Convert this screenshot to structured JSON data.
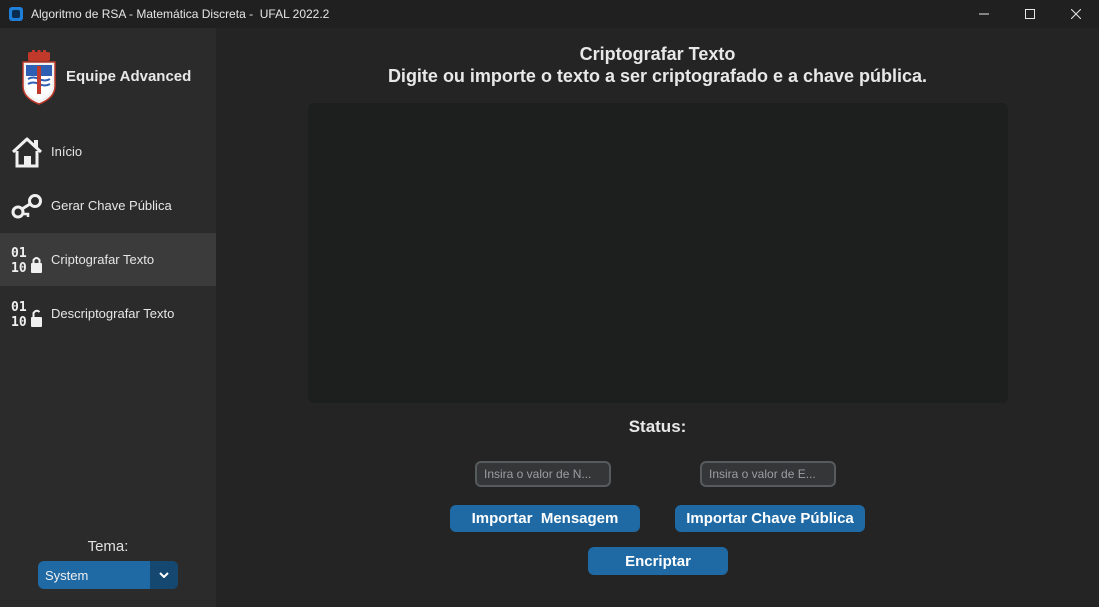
{
  "window": {
    "title": "Algoritmo de RSA - Matemática Discreta -  UFAL 2022.2"
  },
  "sidebar": {
    "team_name": "Equipe Advanced",
    "items": [
      {
        "label": "Início",
        "icon": "home-icon"
      },
      {
        "label": "Gerar Chave Pública",
        "icon": "key-icon"
      },
      {
        "label": "Criptografar Texto",
        "icon": "binary-lock-icon",
        "active": true
      },
      {
        "label": "Descriptografar Texto",
        "icon": "binary-unlock-icon"
      }
    ],
    "theme_label": "Tema:",
    "theme_value": "System"
  },
  "main": {
    "title": "Criptografar Texto",
    "subtitle": "Digite ou importe o texto a ser criptografado e a chave pública.",
    "message_text": "",
    "status_label": "Status:",
    "n_input": {
      "placeholder": "Insira o valor de N...",
      "value": ""
    },
    "e_input": {
      "placeholder": "Insira o valor de E...",
      "value": ""
    },
    "import_message_button": "Importar  Mensagem",
    "import_key_button": "Importar Chave Pública",
    "encrypt_button": "Encriptar"
  },
  "colors": {
    "accent": "#1f6aa5",
    "accent_dark": "#144870",
    "sidebar_bg": "#2b2b2b",
    "main_bg": "#242424",
    "textbox_bg": "#1d1e1e"
  }
}
